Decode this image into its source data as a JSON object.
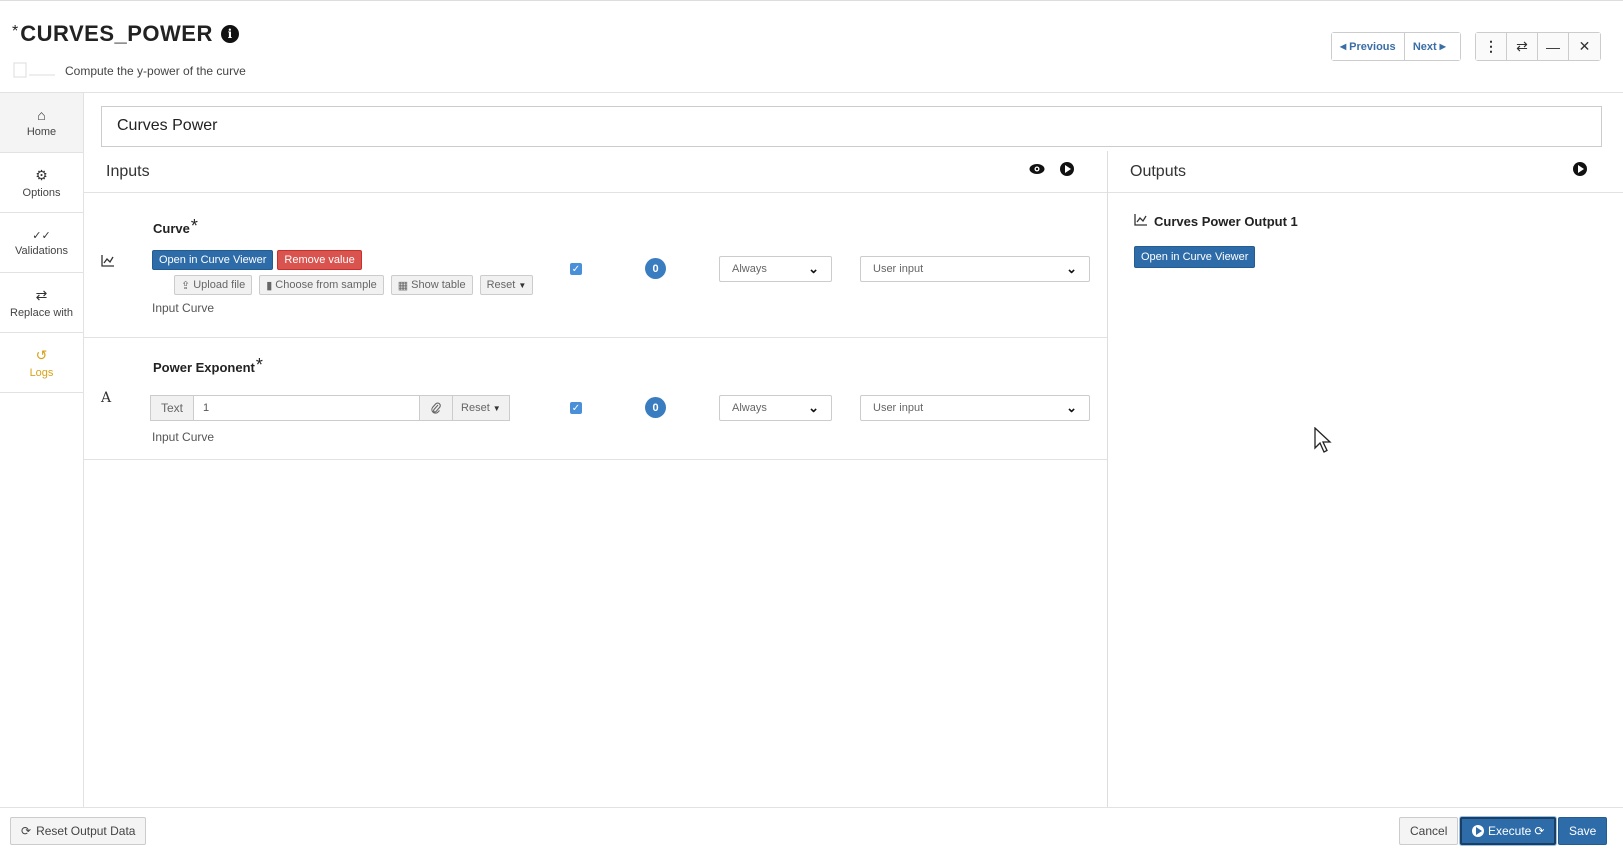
{
  "header": {
    "title_prefix": "*",
    "title": "CURVES_POWER",
    "subtitle": "Compute the y-power of the curve",
    "previous_label": "Previous",
    "next_label": "Next"
  },
  "sidebar": {
    "items": [
      {
        "label": "Home",
        "icon": "home-icon"
      },
      {
        "label": "Options",
        "icon": "gear-icon"
      },
      {
        "label": "Validations",
        "icon": "double-check-icon"
      },
      {
        "label": "Replace with",
        "icon": "swap-icon"
      },
      {
        "label": "Logs",
        "icon": "history-icon"
      }
    ]
  },
  "name_field": {
    "value": "Curves Power"
  },
  "inputs": {
    "title": "Inputs",
    "rows": [
      {
        "label": "Curve",
        "required_mark": "*",
        "type_icon": "chart-line-icon",
        "open_viewer_label": "Open in Curve Viewer",
        "remove_label": "Remove value",
        "upload_label": "Upload file",
        "choose_sample_label": "Choose from sample",
        "show_table_label": "Show table",
        "reset_label": "Reset",
        "description": "Input Curve",
        "badge": "0",
        "condition": "Always",
        "source": "User input"
      },
      {
        "label": "Power Exponent",
        "required_mark": "*",
        "type_icon": "font-icon",
        "type_icon_glyph": "A",
        "text_addon": "Text",
        "value": "1",
        "reset_label": "Reset",
        "description": "Input Curve",
        "badge": "0",
        "condition": "Always",
        "source": "User input"
      }
    ]
  },
  "outputs": {
    "title": "Outputs",
    "items": [
      {
        "label": "Curves Power Output 1",
        "icon": "chart-line-icon",
        "open_viewer_label": "Open in Curve Viewer"
      }
    ]
  },
  "footer": {
    "reset_output_label": "Reset Output Data",
    "cancel_label": "Cancel",
    "execute_label": "Execute",
    "save_label": "Save"
  },
  "colors": {
    "primary": "#2d6ca8",
    "danger": "#d9534f",
    "logs_accent": "#d7a21b",
    "badge": "#3a7cc0"
  }
}
